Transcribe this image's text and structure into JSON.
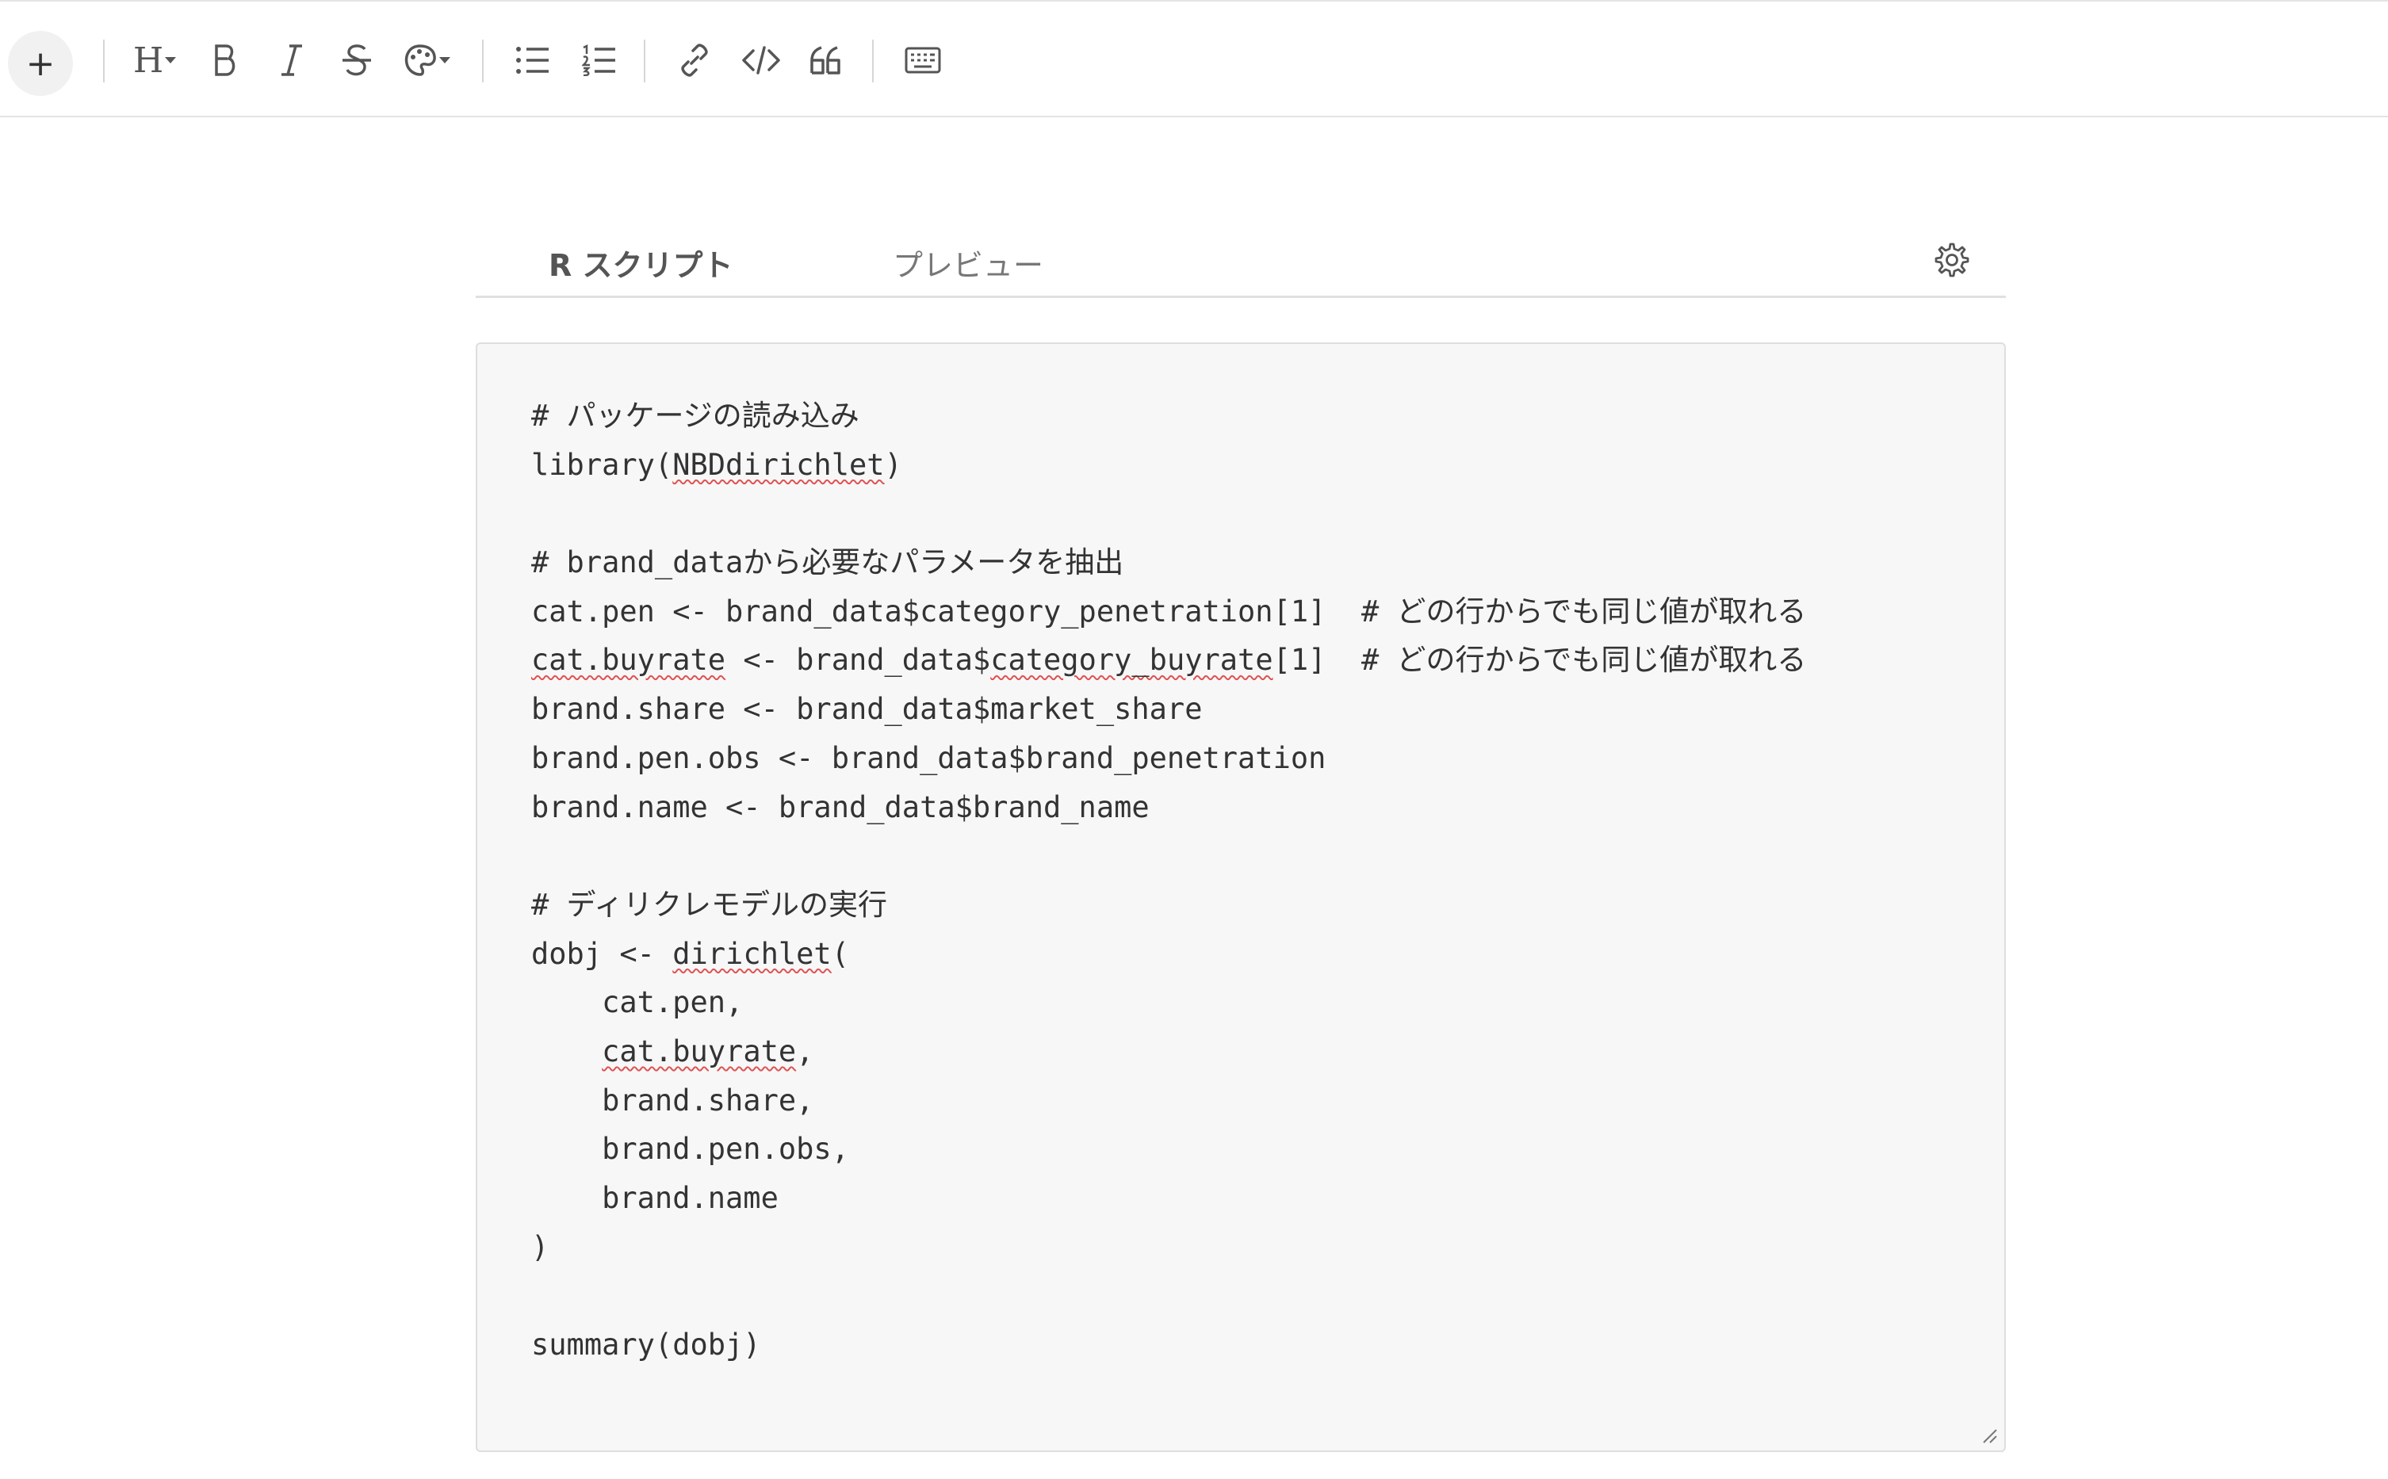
{
  "toolbar": {
    "add_label": "+",
    "heading_label": "H"
  },
  "tabs": [
    {
      "label": "R スクリプト",
      "active": true
    },
    {
      "label": "プレビュー",
      "active": false
    }
  ],
  "editor": {
    "spell_words": [
      "NBDdirichlet",
      "cat.buyrate",
      "category_buyrate",
      "dirichlet"
    ],
    "lines": [
      "# パッケージの読み込み",
      "library(NBDdirichlet)",
      "",
      "# brand_dataから必要なパラメータを抽出",
      "cat.pen <- brand_data$category_penetration[1]  # どの行からでも同じ値が取れる",
      "cat.buyrate <- brand_data$category_buyrate[1]  # どの行からでも同じ値が取れる",
      "brand.share <- brand_data$market_share",
      "brand.pen.obs <- brand_data$brand_penetration",
      "brand.name <- brand_data$brand_name",
      "",
      "# ディリクレモデルの実行",
      "dobj <- dirichlet(",
      "    cat.pen,",
      "    cat.buyrate,",
      "    brand.share,",
      "    brand.pen.obs,",
      "    brand.name",
      ")",
      "",
      "summary(dobj)"
    ]
  }
}
